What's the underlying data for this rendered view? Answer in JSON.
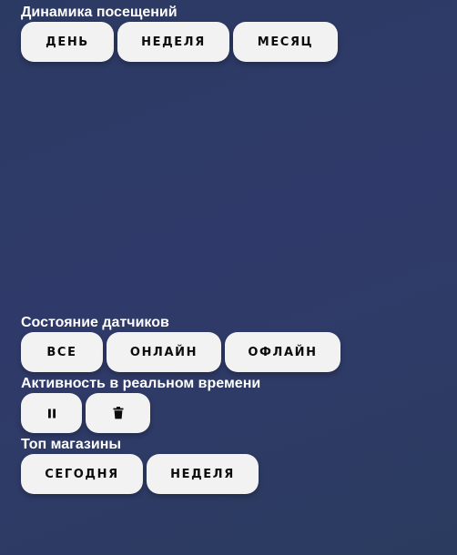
{
  "visits": {
    "title": "Динамика посещений",
    "buttons": {
      "day": "ДЕНЬ",
      "week": "НЕДЕЛЯ",
      "month": "МЕСЯЦ"
    }
  },
  "sensors": {
    "title": "Состояние датчиков",
    "buttons": {
      "all": "ВСЕ",
      "online": "ОНЛАЙН",
      "offline": "ОФЛАЙН"
    }
  },
  "activity": {
    "title": "Активность в реальном времени",
    "icons": [
      "pause-icon",
      "trash-icon"
    ]
  },
  "shops": {
    "title": "Топ магазины",
    "buttons": {
      "today": "СЕГОДНЯ",
      "week": "НЕДЕЛЯ"
    }
  },
  "colors": {
    "button_bg": "#f2f2f2",
    "button_text": "#0b0b0b",
    "title_text": "#ffffff"
  }
}
